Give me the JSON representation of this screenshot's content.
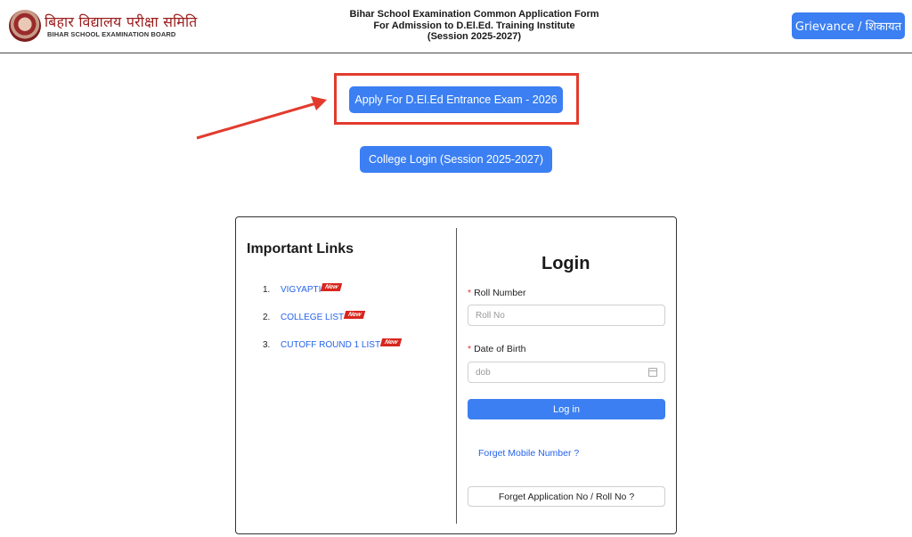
{
  "header": {
    "logo_hindi": "बिहार विद्यालय परीक्षा समिति",
    "logo_english": "BIHAR SCHOOL EXAMINATION BOARD",
    "title_line1": "Bihar School Examination Common Application Form",
    "title_line2": "For Admission to D.El.Ed. Training Institute",
    "title_line3": "(Session 2025-2027)",
    "grievance_label": "Grievance / शिकायत"
  },
  "actions": {
    "apply_label": "Apply For D.El.Ed Entrance Exam - 2026",
    "college_login_label": "College Login (Session 2025-2027)"
  },
  "links": {
    "title": "Important Links",
    "badge": "New",
    "items": [
      {
        "num": "1.",
        "label": "VIGYAPTI"
      },
      {
        "num": "2.",
        "label": "COLLEGE LIST"
      },
      {
        "num": "3.",
        "label": "CUTOFF ROUND 1 LIST"
      }
    ]
  },
  "login": {
    "title": "Login",
    "roll_label": "Roll Number",
    "roll_placeholder": "Roll No",
    "dob_label": "Date of Birth",
    "dob_placeholder": "dob",
    "required_mark": "*",
    "login_button": "Log in",
    "forget_mobile": "Forget Mobile Number ?",
    "forget_application": "Forget Application No / Roll No ?"
  },
  "colors": {
    "primary": "#3b7ff2",
    "highlight": "#e23b2e",
    "brand": "#9b1c1c",
    "link": "#2563eb",
    "badge": "#d7261e"
  }
}
